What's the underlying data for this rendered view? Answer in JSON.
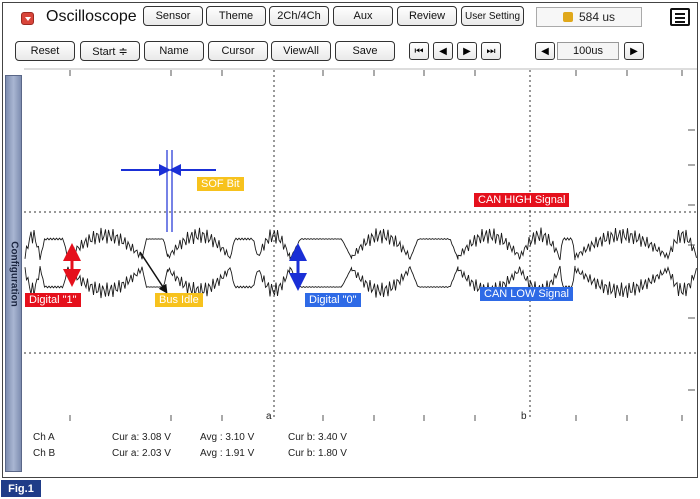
{
  "app": {
    "title": "Oscilloscope"
  },
  "toolbar": {
    "top_buttons": [
      "Sensor",
      "Theme",
      "2Ch/4Ch",
      "Aux",
      "Review",
      "User Setting"
    ],
    "readout": "584 us",
    "controls": {
      "reset": "Reset",
      "start": "Start ≑",
      "name": "Name",
      "cursor": "Cursor",
      "viewall": "ViewAll",
      "save": "Save"
    },
    "nav": [
      "⏮",
      "◀",
      "▶",
      "⏭"
    ],
    "timebase_prev": "◀",
    "timebase": "100us",
    "timebase_next": "▶"
  },
  "side_tab": {
    "label": "Configuration"
  },
  "annotations": {
    "sof_bit": "SOF Bit",
    "can_high": "CAN HIGH Signal",
    "can_low": "CAN LOW Signal",
    "digital_one": "Digital \"1\"",
    "bus_idle": "Bus Idle",
    "digital_zero": "Digital \"0\""
  },
  "cursors": {
    "a_label": "a",
    "b_label": "b"
  },
  "status": {
    "ch_a": {
      "name": "Ch A",
      "cur_a": "Cur a: 3.08 V",
      "avg": "Avg : 3.10 V",
      "cur_b": "Cur b: 3.40 V"
    },
    "ch_b": {
      "name": "Ch B",
      "cur_a": "Cur a: 2.03 V",
      "avg": "Avg : 1.91 V",
      "cur_b": "Cur b: 1.80 V"
    }
  },
  "figure": {
    "tag": "Fig.1"
  },
  "colors": {
    "red": "#e5101c",
    "yellow": "#f7c21d",
    "blue": "#2e6ae6",
    "marker_blue": "#1a2fd6",
    "signal": "#1a1a1a",
    "fig_tag": "#1f3c88"
  }
}
